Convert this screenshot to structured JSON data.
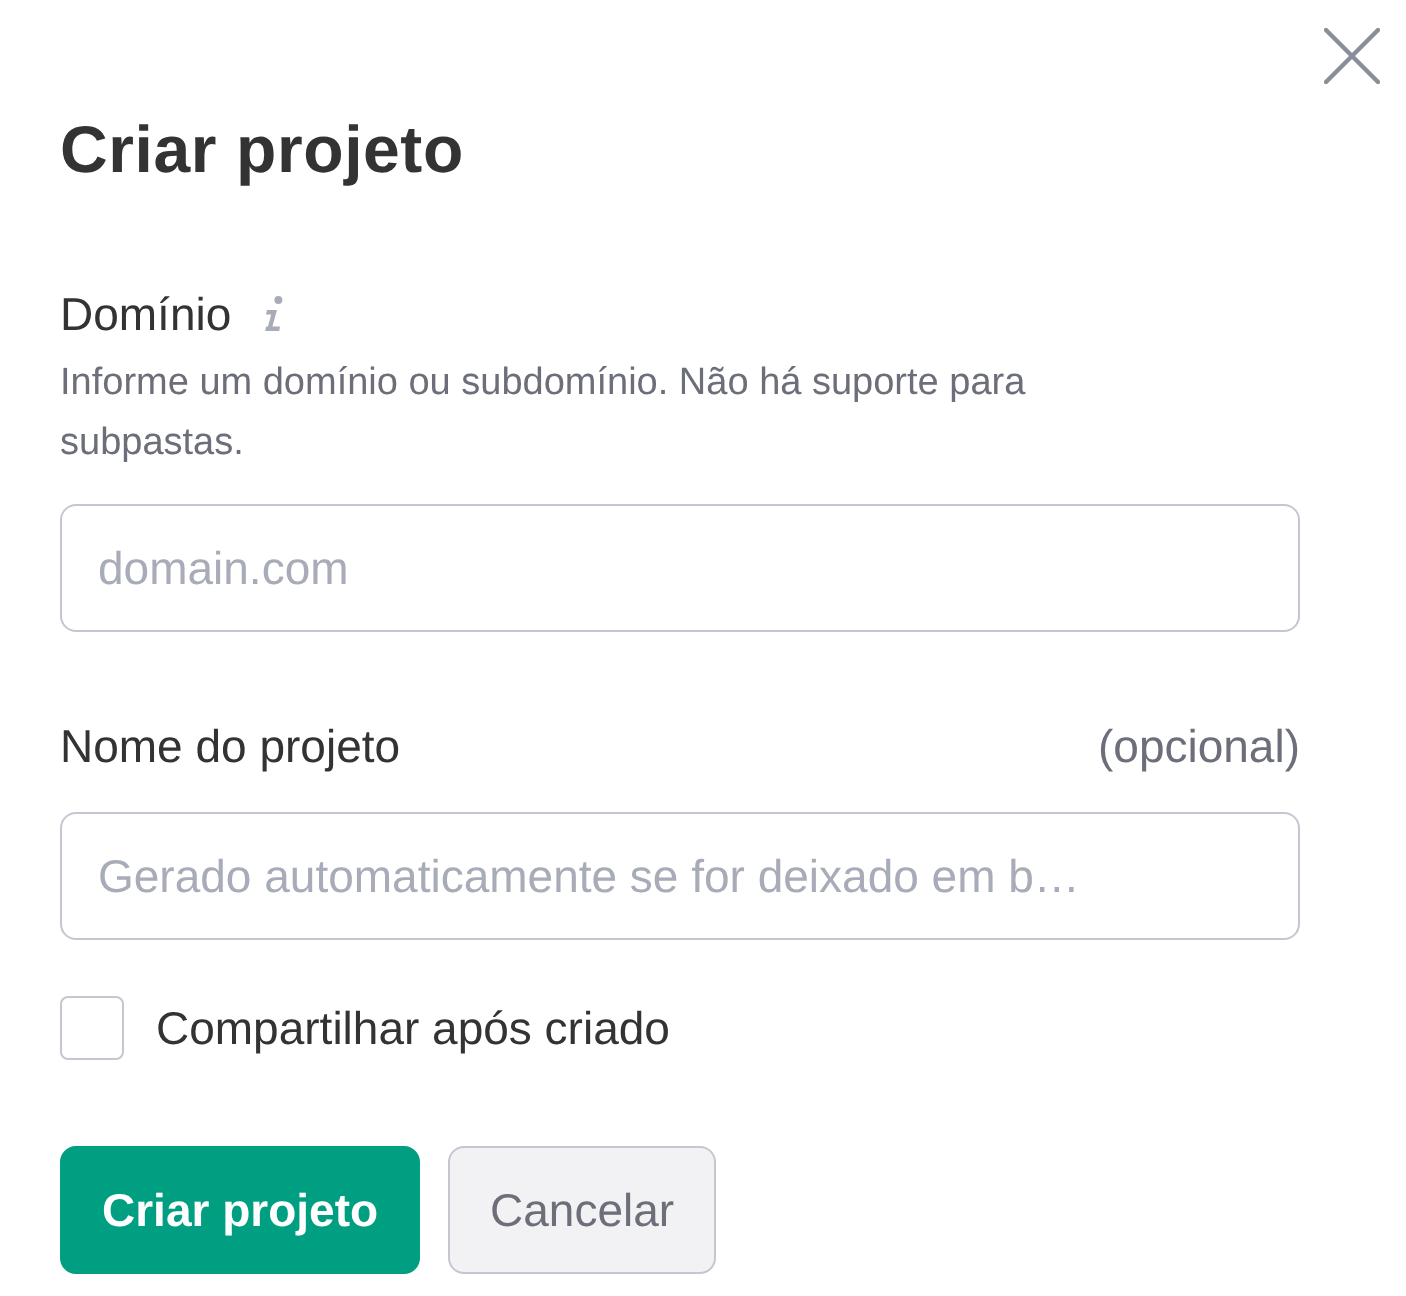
{
  "dialog": {
    "title": "Criar projeto",
    "closable": true
  },
  "fields": [
    {
      "label": "Domínio",
      "info_icon": true,
      "hint": "Informe um domínio ou subdomínio. Não há suporte para subpastas.",
      "placeholder": "domain.com"
    },
    {
      "label": "Nome do projeto",
      "optional": "(opcional)",
      "placeholder": "Gerado automaticamente se for deixado em b…"
    }
  ],
  "checkbox": {
    "label": "Compartilhar após criado",
    "checked": false
  },
  "buttons": [
    {
      "label": "Criar projeto",
      "kind": "primary"
    },
    {
      "label": "Cancelar",
      "kind": "secondary"
    }
  ]
}
